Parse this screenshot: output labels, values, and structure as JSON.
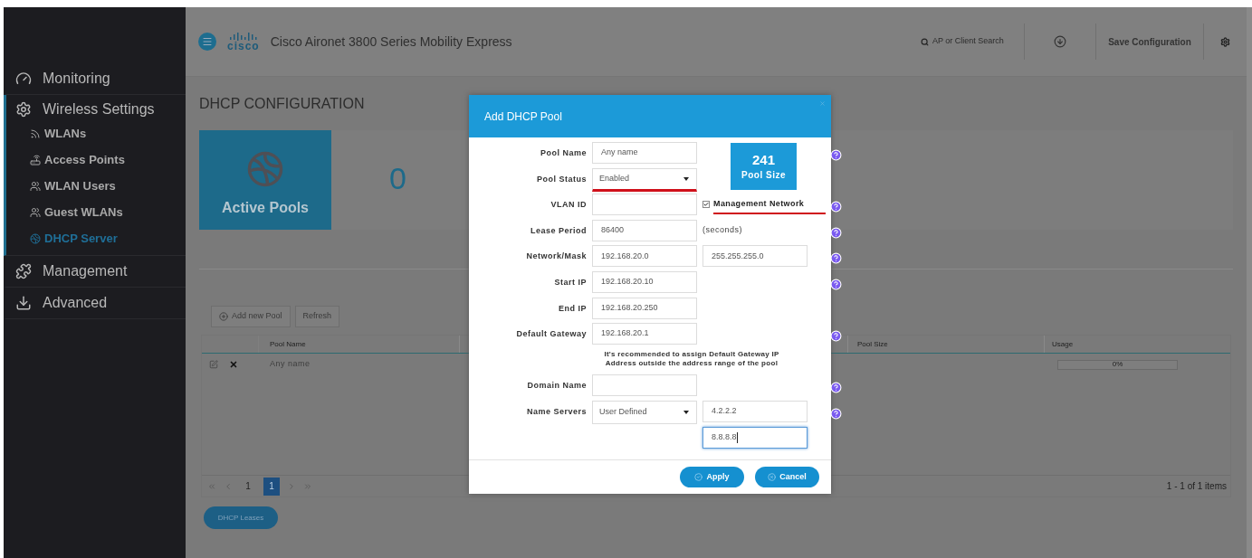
{
  "sidebar": {
    "items": [
      {
        "label": "Monitoring",
        "selected": false
      },
      {
        "label": "Wireless Settings",
        "selected": false,
        "children": [
          {
            "label": "WLANs",
            "selected": false
          },
          {
            "label": "Access Points",
            "selected": false
          },
          {
            "label": "WLAN Users",
            "selected": false
          },
          {
            "label": "Guest WLANs",
            "selected": false
          },
          {
            "label": "DHCP Server",
            "selected": true
          }
        ]
      },
      {
        "label": "Management",
        "selected": false
      },
      {
        "label": "Advanced",
        "selected": false
      }
    ]
  },
  "header": {
    "logo": "cisco",
    "title": "Cisco Aironet 3800 Series Mobility Express",
    "search_placeholder": "AP or Client Search",
    "save_button": "Save Configuration"
  },
  "page": {
    "title": "DHCP CONFIGURATION",
    "active_pools": {
      "label": "Active Pools",
      "count": "0"
    },
    "toolbar": [
      "Add new Pool",
      "Refresh"
    ],
    "table": {
      "columns": [
        "Pool Name",
        "Pool Size",
        "Usage"
      ],
      "rows": [
        {
          "pool_name": "Any name",
          "usage": {
            "text": "0%",
            "level": 0
          }
        }
      ]
    },
    "pagination": {
      "pages": [
        {
          "label": "1",
          "selected": false
        },
        {
          "label": "1",
          "selected": true
        }
      ],
      "info": "1 - 1 of 1 items"
    },
    "leases_button": "DHCP Leases"
  },
  "modal": {
    "title": "Add DHCP Pool",
    "pool_size": {
      "value": "241",
      "label": "Pool Size"
    },
    "rows": [
      {
        "kind": "field",
        "label": "Pool Name",
        "help": true,
        "inputs": [
          {
            "kind": "text",
            "value": "Any name"
          }
        ]
      },
      {
        "kind": "field",
        "label": "Pool Status",
        "help": false,
        "inputs": [
          {
            "kind": "select",
            "value": "Enabled",
            "highlighted": true
          }
        ]
      },
      {
        "kind": "field",
        "label": "VLAN ID",
        "help": true,
        "inputs": [
          {
            "kind": "text"
          },
          {
            "kind": "checkbox",
            "value": "Management Network",
            "checked": true,
            "highlighted": true
          }
        ]
      },
      {
        "kind": "field",
        "label": "Lease Period",
        "help": true,
        "inputs": [
          {
            "kind": "text",
            "value": "86400"
          },
          {
            "kind": "unit",
            "value": "(seconds)"
          }
        ]
      },
      {
        "kind": "field",
        "label": "Network/Mask",
        "help": true,
        "inputs": [
          {
            "kind": "text",
            "value": "192.168.20.0"
          },
          {
            "kind": "text",
            "value": "255.255.255.0"
          }
        ]
      },
      {
        "kind": "field",
        "label": "Start IP",
        "help": true,
        "inputs": [
          {
            "kind": "text",
            "value": "192.168.20.10"
          }
        ]
      },
      {
        "kind": "field",
        "label": "End IP",
        "help": false,
        "inputs": [
          {
            "kind": "text",
            "value": "192.168.20.250"
          }
        ]
      },
      {
        "kind": "field",
        "label": "Default Gateway",
        "help": true,
        "inputs": [
          {
            "kind": "text",
            "value": "192.168.20.1"
          }
        ]
      },
      {
        "kind": "note",
        "text": "It's recommended to assign Default Gateway IP Address outside the address range of the pool"
      },
      {
        "kind": "field",
        "label": "Domain Name",
        "help": true,
        "inputs": [
          {
            "kind": "text"
          }
        ]
      },
      {
        "kind": "field",
        "label": "Name Servers",
        "help": true,
        "inputs": [
          {
            "kind": "select",
            "value": "User Defined",
            "highlighted": false
          },
          {
            "kind": "text",
            "value": "4.2.2.2"
          }
        ]
      },
      {
        "kind": "field",
        "help": false,
        "inputs": [
          {
            "kind": "blank"
          },
          {
            "kind": "text",
            "value": "8.8.8.8",
            "focused": true
          }
        ]
      }
    ],
    "buttons": [
      "Apply",
      "Cancel"
    ]
  }
}
